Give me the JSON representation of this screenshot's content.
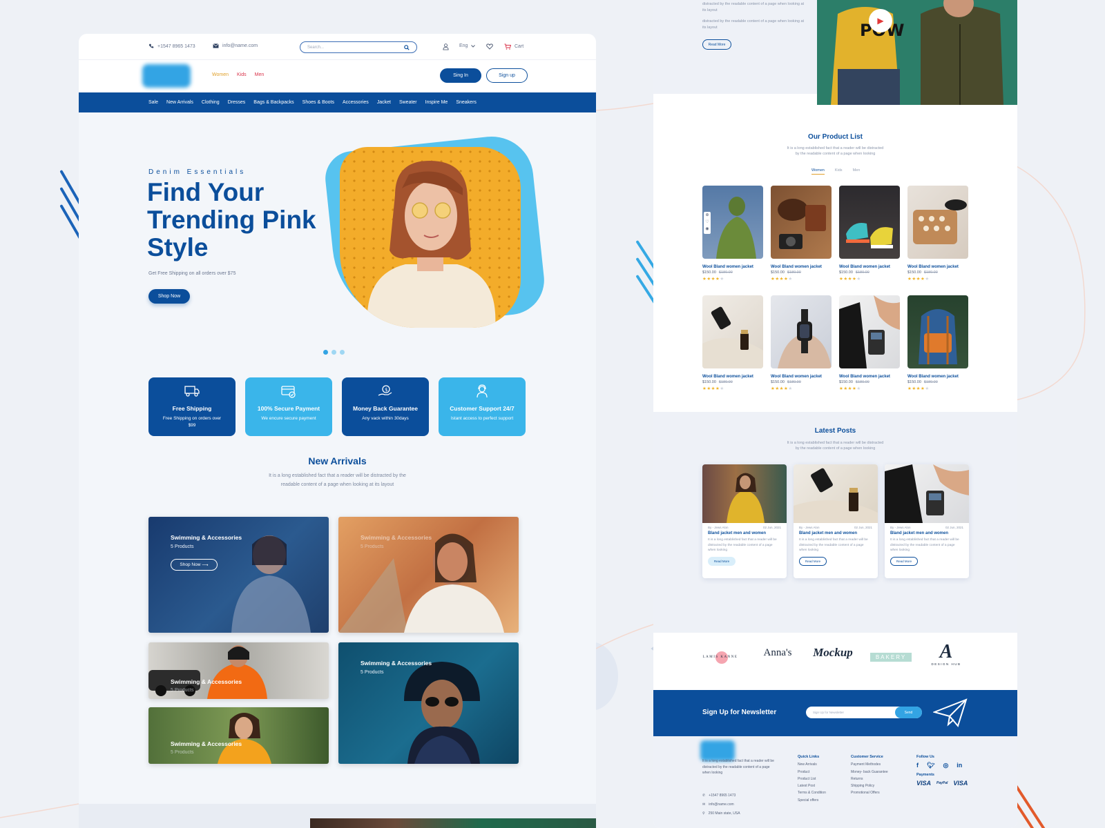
{
  "topbar": {
    "phone": "+1547 8965 1473",
    "email": "info@name.com",
    "search_placeholder": "Search...",
    "language": "Eng",
    "cart": "Cart"
  },
  "header": {
    "categories": [
      "Women",
      "Kids",
      "Men"
    ],
    "signin": "Sing In",
    "signup": "Sign up"
  },
  "nav": [
    "Sale",
    "New Arrivals",
    "Clothing",
    "Dresses",
    "Bags & Backpacks",
    "Shoes & Boots",
    "Accessories",
    "Jacket",
    "Sweater",
    "Inspire Me",
    "Sneakers"
  ],
  "hero": {
    "subtitle": "Denim Essentials",
    "title": "Find Your Trending Pink Style",
    "text": "Get Free Shipping on all orders over $75",
    "button": "Shop Now",
    "slide_count": 3,
    "active_slide": 1
  },
  "features": [
    {
      "title": "Free Shipping",
      "text": "Free Shipping on orders over $99",
      "icon": "truck-icon",
      "style": "dark"
    },
    {
      "title": "100% Secure Payment",
      "text": "We encure secure payment",
      "icon": "card-icon",
      "style": "light"
    },
    {
      "title": "Money Back Guarantee",
      "text": "Any vack within 30days",
      "icon": "money-icon",
      "style": "dark"
    },
    {
      "title": "Customer Support 24/7",
      "text": "Istant access to perfect support",
      "icon": "support-icon",
      "style": "light"
    }
  ],
  "arrivals": {
    "title": "New Arrivals",
    "text_line1": "It is a long established fact that a reader will be distracted by the",
    "text_line2": "readable content of a page when looking at its layout",
    "tiles": [
      {
        "label": "Swimming & Accessories",
        "count": "5 Products",
        "button": "Shop Now"
      },
      {
        "label": "Swimming & Accessories",
        "count": "5 Products"
      },
      {
        "label": "Swimming & Accessories",
        "count": "5 Products"
      },
      {
        "label": "Swimming & Accessories",
        "count": "5 Products"
      },
      {
        "label": "Swimming & Accessories",
        "count": "5 Products"
      }
    ]
  },
  "right": {
    "top_text1": "distracted by the readable content of a page when looking at its layout",
    "top_text2": "distracted by the readable content of a page when looking at its layout",
    "top_button": "Read More",
    "product_list": {
      "title": "Our Product List",
      "text_line1": "It is a long established fact that a reader will be distracted",
      "text_line2": "by the readable content of a page when looking",
      "tabs": [
        "Women",
        "Kids",
        "Men"
      ]
    },
    "products": [
      {
        "name": "Wool Bland women jacket",
        "price": "$150.00",
        "old": "$180.00",
        "rating": 4
      },
      {
        "name": "Wool Bland women jacket",
        "price": "$150.00",
        "old": "$180.00",
        "rating": 4
      },
      {
        "name": "Wool Bland women jacket",
        "price": "$150.00",
        "old": "$180.00",
        "rating": 4
      },
      {
        "name": "Wool Bland women jacket",
        "price": "$150.00",
        "old": "$180.00",
        "rating": 4
      },
      {
        "name": "Wool Bland women jacket",
        "price": "$150.00",
        "old": "$180.00",
        "rating": 4
      },
      {
        "name": "Wool Bland women jacket",
        "price": "$150.00",
        "old": "$180.00",
        "rating": 4
      },
      {
        "name": "Wool Bland women jacket",
        "price": "$150.00",
        "old": "$180.00",
        "rating": 4
      },
      {
        "name": "Wool Bland women jacket",
        "price": "$150.00",
        "old": "$180.00",
        "rating": 4
      }
    ],
    "posts_section": {
      "title": "Latest Posts",
      "text_line1": "It is a long established fact that a reader will be distracted",
      "text_line2": "by the readable content of a page when looking"
    },
    "posts": [
      {
        "author": "By - Jews Alon",
        "date": "02 Jun, 2021",
        "title": "Bland jacket men and women",
        "text": "It is a long established fact that a reader will be distracted by the readable content of a page when looking",
        "button": "Read More"
      },
      {
        "author": "By - Jews Alon",
        "date": "02 Jun, 2021",
        "title": "Bland jacket men and women",
        "text": "It is a long established fact that a reader will be distracted by the readable content of a page when looking",
        "button": "Read More"
      },
      {
        "author": "By - Jews Alon",
        "date": "02 Jun, 2021",
        "title": "Bland jacket men and women",
        "text": "It is a long established fact that a reader will be distracted by the readable content of a page when looking",
        "button": "Read More"
      }
    ],
    "brands": [
      "LAMIS KANNE",
      "Anna's",
      "Mockup",
      "BAKERY",
      "DESIGN HUB"
    ],
    "newsletter": {
      "title": "Sign Up for Newsletter",
      "placeholder": "Sign Up for Newsletter",
      "button": "Send"
    },
    "footer": {
      "about": "It is a long established fact that a reader will be distracted by the readable content of a page when looking",
      "phone": "+1547 8965 1473",
      "email": "info@name.com",
      "address": "250 Main state, USA",
      "quick_links_title": "Quick Links",
      "quick_links": [
        "New Arrivals",
        "Product",
        "Product List",
        "Latest Post",
        "Terms & Condition",
        "Special offers"
      ],
      "service_title": "Customer Service",
      "service_links": [
        "Payment Methodes",
        "Money- back Guarantee",
        "Returns",
        "Shipping Policy",
        "Promotional Offers"
      ],
      "follow_title": "Follow Us",
      "payments_title": "Payments",
      "payments": [
        "VISA",
        "PayPal",
        "VISA"
      ]
    }
  },
  "colors": {
    "primary": "#0b4e9b",
    "accent": "#33a4e4",
    "star": "#f0b428",
    "orange": "#e25a2b"
  }
}
